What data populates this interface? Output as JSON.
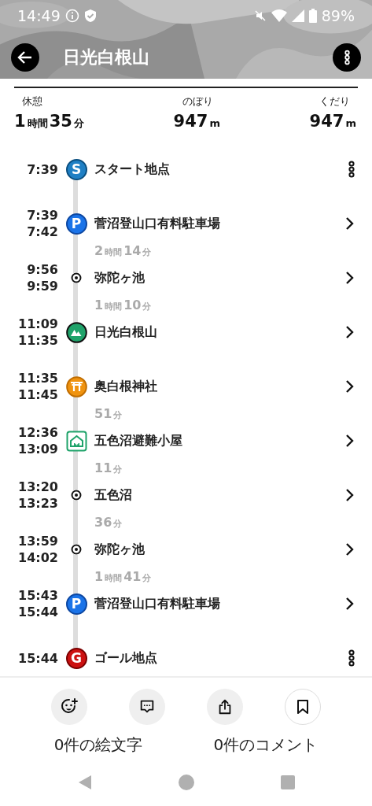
{
  "status_bar": {
    "time": "14:49",
    "battery": "89%"
  },
  "header": {
    "title": "日光白根山"
  },
  "summary": [
    {
      "label": "休憩",
      "value": [
        {
          "kind": "number",
          "text": "1"
        },
        {
          "kind": "unit",
          "text": "時間"
        },
        {
          "kind": "number",
          "text": "35"
        },
        {
          "kind": "unit",
          "text": "分"
        }
      ]
    },
    {
      "label": "のぼり",
      "value": [
        {
          "kind": "number",
          "text": "947"
        },
        {
          "kind": "unit",
          "text": "m"
        }
      ]
    },
    {
      "label": "くだり",
      "value": [
        {
          "kind": "number",
          "text": "947"
        },
        {
          "kind": "unit",
          "text": "m"
        }
      ]
    }
  ],
  "stops": [
    {
      "times": [
        "7:39"
      ],
      "name": "スタート地点",
      "kind": "start",
      "marker": "S",
      "action": {
        "kind": "more"
      }
    },
    {
      "times": [
        "7:39",
        "7:42"
      ],
      "name": "菅沼登山口有料駐車場",
      "kind": "parking",
      "marker": "P",
      "action": {
        "kind": "open"
      },
      "duration": [
        {
          "kind": "number",
          "text": "2"
        },
        {
          "kind": "unit",
          "text": "時間"
        },
        {
          "kind": "number",
          "text": "14"
        },
        {
          "kind": "unit",
          "text": "分"
        }
      ]
    },
    {
      "times": [
        "9:56",
        "9:59"
      ],
      "name": "弥陀ヶ池",
      "kind": "point",
      "action": {
        "kind": "open"
      },
      "duration": [
        {
          "kind": "number",
          "text": "1"
        },
        {
          "kind": "unit",
          "text": "時間"
        },
        {
          "kind": "number",
          "text": "10"
        },
        {
          "kind": "unit",
          "text": "分"
        }
      ]
    },
    {
      "times": [
        "11:09",
        "11:35"
      ],
      "name": "日光白根山",
      "kind": "summit",
      "action": {
        "kind": "open"
      }
    },
    {
      "times": [
        "11:35",
        "11:45"
      ],
      "name": "奥白根神社",
      "kind": "shrine",
      "action": {
        "kind": "open"
      },
      "duration": [
        {
          "kind": "number",
          "text": "51"
        },
        {
          "kind": "unit",
          "text": "分"
        }
      ]
    },
    {
      "times": [
        "12:36",
        "13:09"
      ],
      "name": "五色沼避難小屋",
      "kind": "hut",
      "action": {
        "kind": "open"
      },
      "duration": [
        {
          "kind": "number",
          "text": "11"
        },
        {
          "kind": "unit",
          "text": "分"
        }
      ]
    },
    {
      "times": [
        "13:20",
        "13:23"
      ],
      "name": "五色沼",
      "kind": "point",
      "action": {
        "kind": "open"
      },
      "duration": [
        {
          "kind": "number",
          "text": "36"
        },
        {
          "kind": "unit",
          "text": "分"
        }
      ]
    },
    {
      "times": [
        "13:59",
        "14:02"
      ],
      "name": "弥陀ヶ池",
      "kind": "point",
      "action": {
        "kind": "open"
      },
      "duration": [
        {
          "kind": "number",
          "text": "1"
        },
        {
          "kind": "unit",
          "text": "時間"
        },
        {
          "kind": "number",
          "text": "41"
        },
        {
          "kind": "unit",
          "text": "分"
        }
      ]
    },
    {
      "times": [
        "15:43",
        "15:44"
      ],
      "name": "菅沼登山口有料駐車場",
      "kind": "parking",
      "marker": "P",
      "action": {
        "kind": "open"
      }
    },
    {
      "times": [
        "15:44"
      ],
      "name": "ゴール地点",
      "kind": "goal",
      "marker": "G",
      "action": {
        "kind": "more"
      }
    }
  ],
  "actions": [
    {
      "kind": "emoji"
    },
    {
      "kind": "comment"
    },
    {
      "kind": "share"
    },
    {
      "kind": "bookmark"
    }
  ],
  "counts": [
    "0件の絵文字",
    "0件のコメント"
  ]
}
